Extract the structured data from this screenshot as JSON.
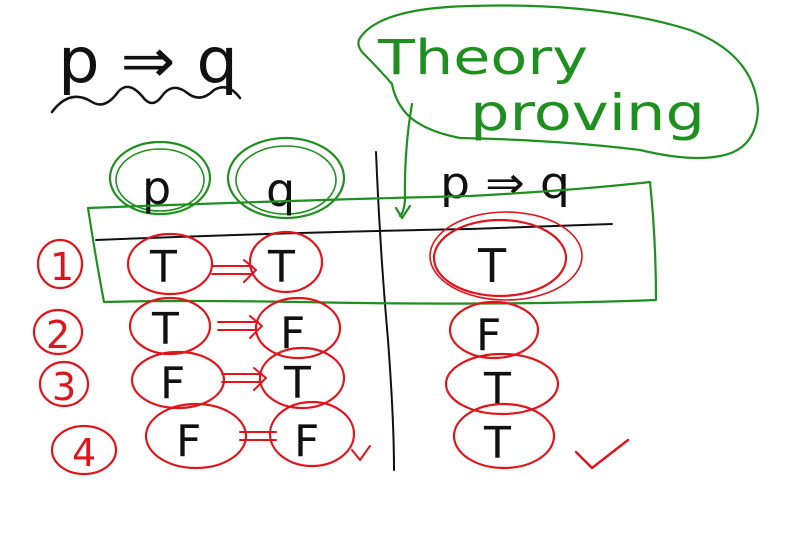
{
  "title": {
    "formula": "p ⇒ q"
  },
  "note": {
    "line1": "Theory",
    "line2": "proving"
  },
  "table": {
    "headers": [
      "p",
      "q",
      "p ⇒ q"
    ],
    "rows": [
      {
        "num": "1",
        "p": "T",
        "q": "T",
        "result": "T"
      },
      {
        "num": "2",
        "p": "T",
        "q": "F",
        "result": "F"
      },
      {
        "num": "3",
        "p": "F",
        "q": "T",
        "result": "T"
      },
      {
        "num": "4",
        "p": "F",
        "q": "F",
        "result": "T"
      }
    ]
  },
  "colors": {
    "black": "#111111",
    "green": "#1f8f1f",
    "red": "#e0151b"
  }
}
